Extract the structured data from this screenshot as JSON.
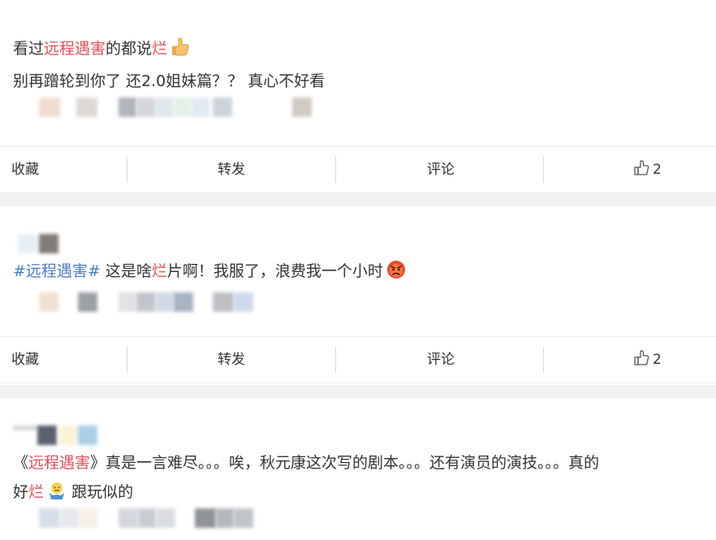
{
  "posts": [
    {
      "line1_pre": "看过",
      "line1_tag": "远程遇害",
      "line1_mid": "的都说",
      "line1_hl": "烂",
      "line1_emoji": "thumbs-up-emoji",
      "line2": "别再蹭轮到你了 还2.0姐妹篇？？ 真心不好看",
      "actions": {
        "fav": "收藏",
        "repost": "转发",
        "comment": "评论",
        "likes": "2"
      }
    },
    {
      "tag": "#远程遇害#",
      "pre": " 这是啥",
      "hl": "烂",
      "post": "片啊！我服了，浪费我一个小时",
      "emoji": "angry-face-emoji",
      "actions": {
        "fav": "收藏",
        "repost": "转发",
        "comment": "评论",
        "likes": "2"
      }
    },
    {
      "open": "《",
      "tag": "远程遇害",
      "rest": "》真是一言难尽。。。唉，秋元康这次写的剧本。。。还有演员的演技。。。真的",
      "line2_pre": "好",
      "line2_hl": "烂",
      "line2_emoji": "shrug-emoji",
      "line2_post": " 跟玩似的"
    }
  ],
  "colors": {
    "highlight": "#e0505a",
    "hashtag": "#4a7dbe",
    "separator_bg": "#f2f2f2"
  },
  "icons": [
    "thumbs-up-icon"
  ]
}
